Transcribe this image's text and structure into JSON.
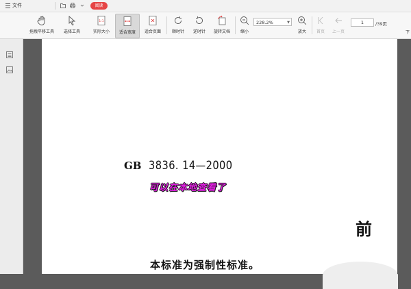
{
  "menubar": {
    "file_label": "文件",
    "read_badge": "阅读"
  },
  "toolbar": {
    "tools": [
      {
        "id": "hand",
        "label": "拖拽平移工具"
      },
      {
        "id": "select",
        "label": "选择工具"
      },
      {
        "id": "actual-size",
        "label": "实际大小"
      },
      {
        "id": "fit-width",
        "label": "适合宽度"
      },
      {
        "id": "fit-page",
        "label": "适合页面"
      },
      {
        "id": "rotate-ccw",
        "label": "顺时针"
      },
      {
        "id": "rotate-cw",
        "label": "逆时针"
      },
      {
        "id": "rotate-doc",
        "label": "旋转文档"
      },
      {
        "id": "zoom-out",
        "label": "缩小"
      },
      {
        "id": "zoom-in",
        "label": "放大"
      },
      {
        "id": "first-page",
        "label": "首页"
      },
      {
        "id": "prev-page",
        "label": "上一页"
      }
    ],
    "zoom_value": "228.2%",
    "page_current": "1",
    "page_total": "/39页",
    "next_label": "下"
  },
  "document": {
    "code_prefix": "GB",
    "code_number": "3836. 14—2000",
    "watermark": "可以在本地查看了",
    "heading": "前",
    "body_line": "本标准为强制性标准。"
  }
}
